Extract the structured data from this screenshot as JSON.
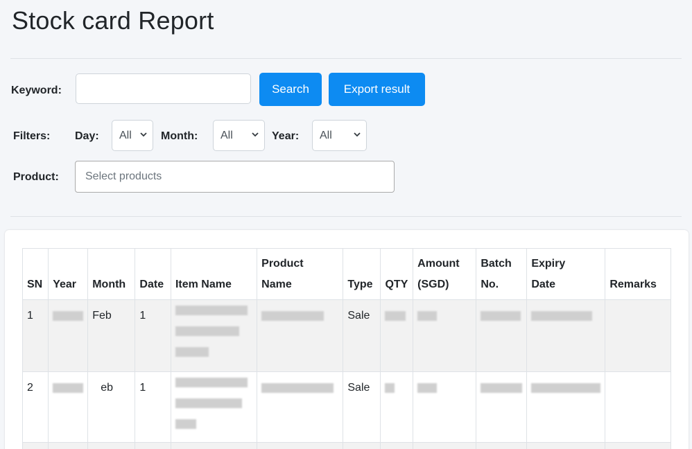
{
  "page": {
    "title": "Stock card Report"
  },
  "search": {
    "keyword_label": "Keyword:",
    "keyword_value": "",
    "search_button": "Search",
    "export_button": "Export result"
  },
  "filters": {
    "label": "Filters:",
    "day_label": "Day:",
    "day_value": "All",
    "month_label": "Month:",
    "month_value": "All",
    "year_label": "Year:",
    "year_value": "All"
  },
  "product": {
    "label": "Product:",
    "placeholder": "Select products"
  },
  "table": {
    "headers": {
      "sn": "SN",
      "year": "Year",
      "month": "Month",
      "date": "Date",
      "item_name": "Item Name",
      "product_name_1": "Product",
      "product_name_2": "Name",
      "type": "Type",
      "qty": "QTY",
      "amount_1": "Amount",
      "amount_2": "(SGD)",
      "batch_1": "Batch",
      "batch_2": "No.",
      "expiry_1": "Expiry",
      "expiry_2": "Date",
      "remarks": "Remarks"
    },
    "rows": [
      {
        "sn": "1",
        "month": "Feb",
        "date": "1",
        "type": "Sale"
      },
      {
        "sn": "2",
        "month": "eb",
        "date": "1",
        "type": "Sale"
      }
    ]
  },
  "colors": {
    "primary_button": "#0d8bf2",
    "page_bg": "#f4f6f9"
  }
}
